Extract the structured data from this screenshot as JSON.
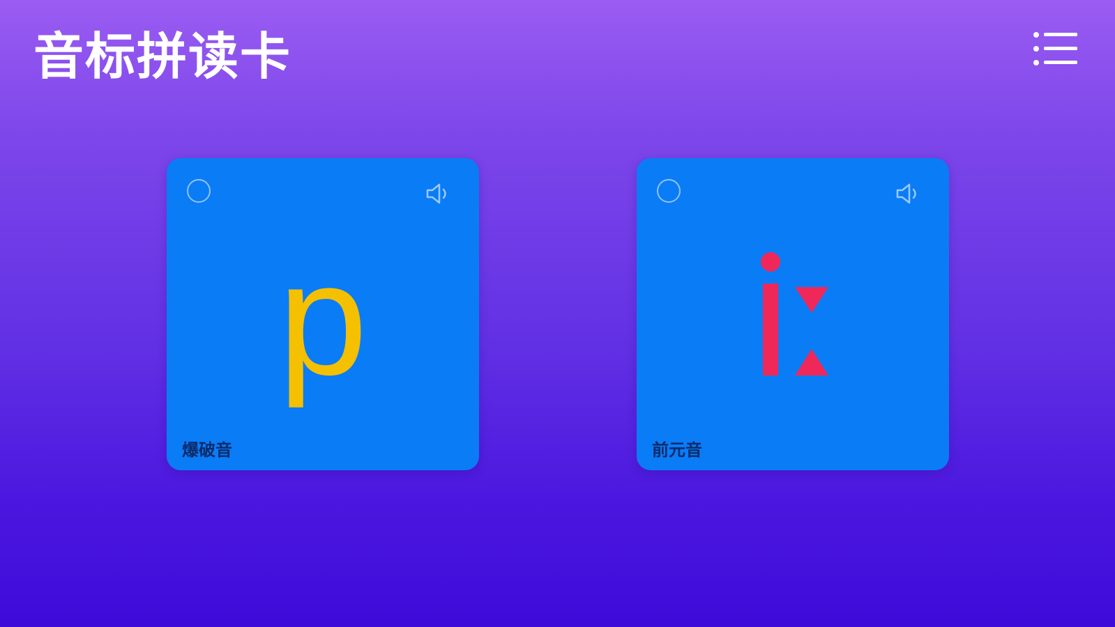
{
  "header": {
    "title": "音标拼读卡",
    "menu_icon": "list-menu-icon"
  },
  "cards": [
    {
      "symbol": "p",
      "category": "爆破音",
      "symbol_color": "#f5c000",
      "selected": false,
      "speaker_icon": "speaker-icon"
    },
    {
      "symbol": "iː",
      "category": "前元音",
      "symbol_color": "#f0285a",
      "selected": false,
      "speaker_icon": "speaker-icon"
    }
  ],
  "colors": {
    "card_background": "#0a7cf6",
    "background_top": "#9a5cf2",
    "background_bottom": "#3e0ad9",
    "category_text": "#0b2b6b"
  }
}
